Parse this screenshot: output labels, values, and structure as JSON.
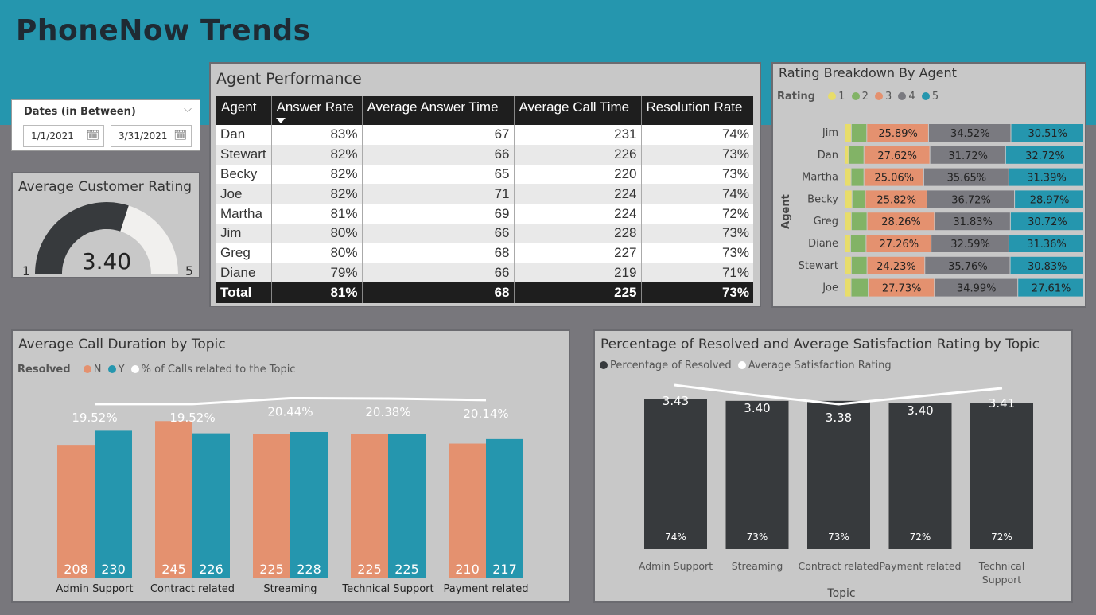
{
  "page_title": "PhoneNow Trends",
  "slicer": {
    "label": "Dates (in Between)",
    "start": "1/1/2021",
    "end": "3/31/2021"
  },
  "gauge": {
    "title": "Average Customer Rating",
    "value": 3.4,
    "value_label": "3.40",
    "min": 1,
    "min_label": "1",
    "max": 5,
    "max_label": "5"
  },
  "agent_table": {
    "title": "Agent Performance",
    "columns": [
      "Agent",
      "Answer Rate",
      "Average Answer Time",
      "Average Call Time",
      "Resolution Rate"
    ],
    "rows": [
      [
        "Dan",
        "83%",
        "67",
        "231",
        "74%"
      ],
      [
        "Stewart",
        "82%",
        "66",
        "226",
        "73%"
      ],
      [
        "Becky",
        "82%",
        "65",
        "220",
        "73%"
      ],
      [
        "Joe",
        "82%",
        "71",
        "224",
        "74%"
      ],
      [
        "Martha",
        "81%",
        "69",
        "224",
        "72%"
      ],
      [
        "Jim",
        "80%",
        "66",
        "228",
        "73%"
      ],
      [
        "Greg",
        "80%",
        "68",
        "227",
        "73%"
      ],
      [
        "Diane",
        "79%",
        "66",
        "219",
        "71%"
      ]
    ],
    "total": [
      "Total",
      "81%",
      "68",
      "225",
      "73%"
    ]
  },
  "colors": {
    "c1": "#e8dd6a",
    "c2": "#82b366",
    "c3": "#e4916f",
    "c4": "#7a7a80",
    "c5": "#2596ae",
    "dark": "#373a3d",
    "n": "#e4916f",
    "y": "#2596ae"
  },
  "chart_data": [
    {
      "type": "bar",
      "orientation": "horizontal",
      "stacked": true,
      "percent": true,
      "title": "Rating Breakdown By Agent",
      "ylabel": "Agent",
      "legend_title": "Rating",
      "legend_position": "top-left",
      "categories": [
        "Jim",
        "Dan",
        "Martha",
        "Becky",
        "Greg",
        "Diane",
        "Stewart",
        "Joe"
      ],
      "series": [
        {
          "name": "1",
          "values": [
            2.6,
            1.5,
            2.5,
            2.9,
            2.6,
            2.3,
            2.6,
            2.5
          ]
        },
        {
          "name": "2",
          "values": [
            6.5,
            6.4,
            5.4,
            5.6,
            6.6,
            6.5,
            6.6,
            7.2
          ]
        },
        {
          "name": "3",
          "values": [
            25.89,
            27.62,
            25.06,
            25.82,
            28.26,
            27.26,
            24.23,
            27.73
          ]
        },
        {
          "name": "4",
          "values": [
            34.52,
            31.72,
            35.65,
            36.72,
            31.83,
            32.59,
            35.76,
            34.99
          ]
        },
        {
          "name": "5",
          "values": [
            30.51,
            32.72,
            31.39,
            28.97,
            30.72,
            31.36,
            30.83,
            27.61
          ]
        }
      ],
      "data_labels": [
        [
          "25.89%",
          "34.52%",
          "30.51%"
        ],
        [
          "27.62%",
          "31.72%",
          "32.72%"
        ],
        [
          "25.06%",
          "35.65%",
          "31.39%"
        ],
        [
          "25.82%",
          "36.72%",
          "28.97%"
        ],
        [
          "28.26%",
          "31.83%",
          "30.72%"
        ],
        [
          "27.26%",
          "32.59%",
          "31.36%"
        ],
        [
          "24.23%",
          "35.76%",
          "30.83%"
        ],
        [
          "27.73%",
          "34.99%",
          "27.61%"
        ]
      ]
    },
    {
      "type": "bar",
      "title": "Average Call Duration by Topic",
      "legend_title": "Resolved",
      "legend_position": "top-left",
      "categories": [
        "Admin Support",
        "Contract related",
        "Streaming",
        "Technical Support",
        "Payment related"
      ],
      "series": [
        {
          "name": "N",
          "values": [
            208,
            245,
            225,
            225,
            210
          ]
        },
        {
          "name": "Y",
          "values": [
            230,
            226,
            228,
            225,
            217
          ]
        }
      ],
      "line_series": {
        "name": "% of Calls related to the Topic",
        "values": [
          19.52,
          19.52,
          20.44,
          20.38,
          20.14
        ],
        "labels": [
          "19.52%",
          "19.52%",
          "20.44%",
          "20.38%",
          "20.14%"
        ]
      },
      "ylim": [
        0,
        260
      ]
    },
    {
      "type": "bar",
      "title": "Percentage of Resolved and Average Satisfaction Rating by Topic",
      "xlabel": "Topic",
      "legend_position": "top-left",
      "categories": [
        "Admin Support",
        "Streaming",
        "Contract related",
        "Payment related",
        "Technical Support"
      ],
      "series": [
        {
          "name": "Percentage of Resolved",
          "values": [
            74,
            73,
            73,
            72,
            72
          ],
          "labels": [
            "74%",
            "73%",
            "73%",
            "72%",
            "72%"
          ]
        }
      ],
      "line_series": {
        "name": "Average Satisfaction Rating",
        "values": [
          3.43,
          3.4,
          3.38,
          3.4,
          3.41
        ],
        "labels": [
          "3.43",
          "3.40",
          "3.38",
          "3.40",
          "3.41"
        ]
      },
      "ylim": [
        0,
        90
      ]
    }
  ]
}
